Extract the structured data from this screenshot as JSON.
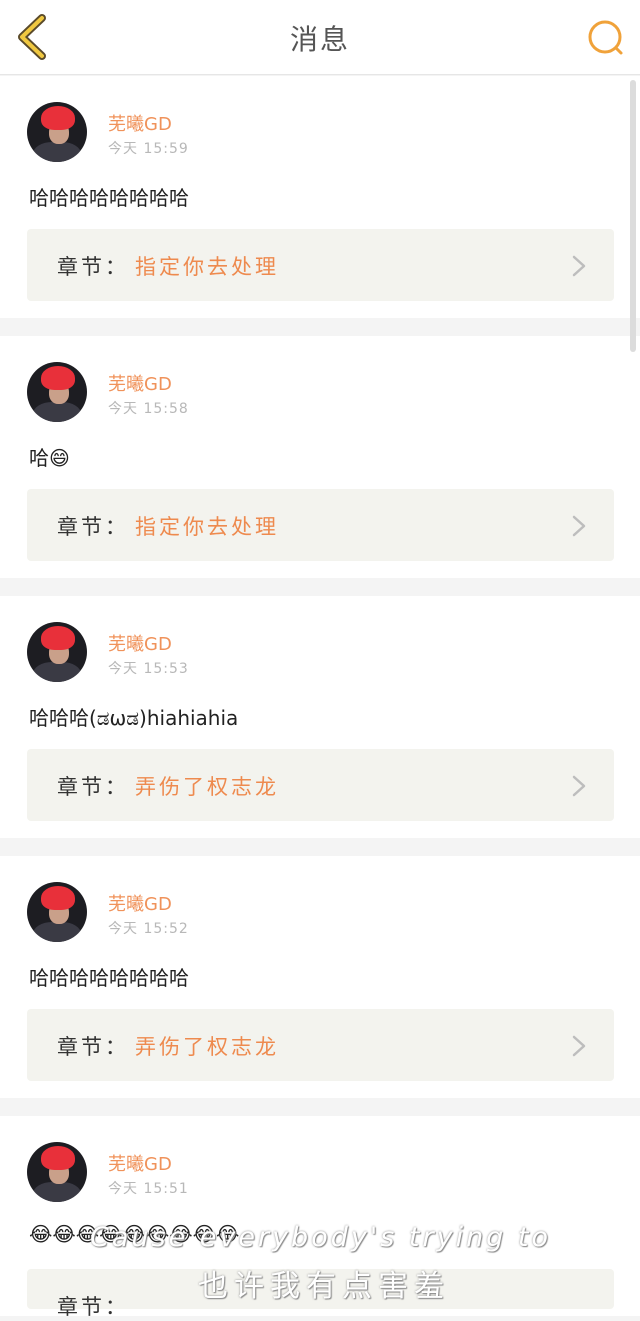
{
  "header": {
    "title": "消息",
    "back_icon": "chevron-left-icon",
    "search_icon": "search-icon",
    "accent": "#f0a23a"
  },
  "messages": [
    {
      "username": "芜曦GD",
      "time": "今天 15:59",
      "content": "哈哈哈哈哈哈哈哈",
      "chapter_label": "章节：",
      "chapter_title": "指定你去处理"
    },
    {
      "username": "芜曦GD",
      "time": "今天 15:58",
      "content": "哈😄",
      "chapter_label": "章节：",
      "chapter_title": "指定你去处理"
    },
    {
      "username": "芜曦GD",
      "time": "今天 15:53",
      "content": "哈哈哈(ಡωಡ)hiahiahia",
      "chapter_label": "章节：",
      "chapter_title": "弄伤了权志龙"
    },
    {
      "username": "芜曦GD",
      "time": "今天 15:52",
      "content": "哈哈哈哈哈哈哈哈",
      "chapter_label": "章节：",
      "chapter_title": "弄伤了权志龙"
    },
    {
      "username": "芜曦GD",
      "time": "今天 15:51",
      "content": "😂😂😂😂😂😂😂😂😂",
      "chapter_label": "章节：",
      "chapter_title": ""
    }
  ],
  "subtitle": {
    "line1": "Cause everybody's trying to",
    "line2": "也许我有点害羞"
  },
  "colors": {
    "username": "#f0925a",
    "chapter_title": "#ee8a4e",
    "chapter_bg": "#f3f3ee"
  }
}
